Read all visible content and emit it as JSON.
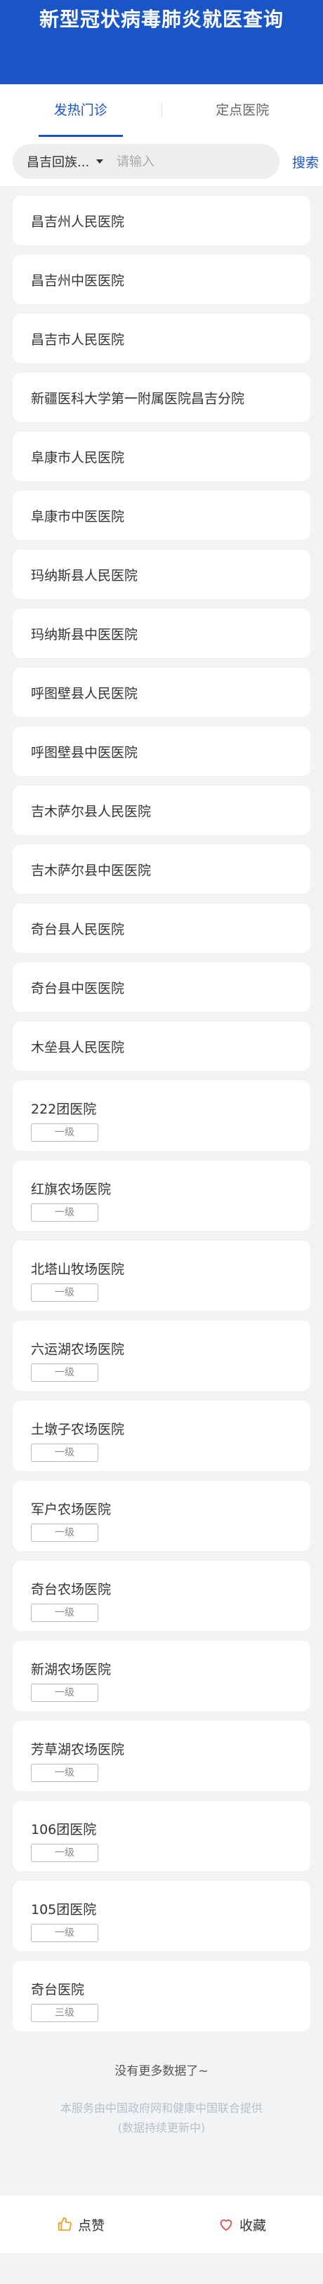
{
  "header": {
    "title": "新型冠状病毒肺炎就医查询"
  },
  "tabs": [
    {
      "label": "发热门诊",
      "active": true
    },
    {
      "label": "定点医院",
      "active": false
    }
  ],
  "search": {
    "region": "昌吉回族...",
    "placeholder": "请输入",
    "button_label": "搜索"
  },
  "hospitals": [
    {
      "name": "昌吉州人民医院"
    },
    {
      "name": "昌吉州中医医院"
    },
    {
      "name": "昌吉市人民医院"
    },
    {
      "name": "新疆医科大学第一附属医院昌吉分院"
    },
    {
      "name": "阜康市人民医院"
    },
    {
      "name": "阜康市中医医院"
    },
    {
      "name": "玛纳斯县人民医院"
    },
    {
      "name": "玛纳斯县中医医院"
    },
    {
      "name": "呼图壁县人民医院"
    },
    {
      "name": "呼图壁县中医医院"
    },
    {
      "name": "吉木萨尔县人民医院"
    },
    {
      "name": "吉木萨尔县中医医院"
    },
    {
      "name": "奇台县人民医院"
    },
    {
      "name": "奇台县中医医院"
    },
    {
      "name": "木垒县人民医院"
    },
    {
      "name": "222团医院",
      "level": "一级"
    },
    {
      "name": "红旗农场医院",
      "level": "一级"
    },
    {
      "name": "北塔山牧场医院",
      "level": "一级"
    },
    {
      "name": "六运湖农场医院",
      "level": "一级"
    },
    {
      "name": "土墩子农场医院",
      "level": "一级"
    },
    {
      "name": "军户农场医院",
      "level": "一级"
    },
    {
      "name": "奇台农场医院",
      "level": "一级"
    },
    {
      "name": "新湖农场医院",
      "level": "一级"
    },
    {
      "name": "芳草湖农场医院",
      "level": "一级"
    },
    {
      "name": "106团医院",
      "level": "一级"
    },
    {
      "name": "105团医院",
      "level": "一级"
    },
    {
      "name": "奇台医院",
      "level": "三级"
    }
  ],
  "list_end": "没有更多数据了~",
  "footer": {
    "line1": "本服务由中国政府网和健康中国联合提供",
    "line2": "(数据持续更新中)"
  },
  "bottom_bar": {
    "like_label": "点赞",
    "like_icon": "thumbs-up-icon",
    "fav_label": "收藏",
    "fav_icon": "heart-icon"
  },
  "colors": {
    "brand": "#1a55c7",
    "like_icon": "#f0a020",
    "fav_icon": "#e0505a"
  }
}
